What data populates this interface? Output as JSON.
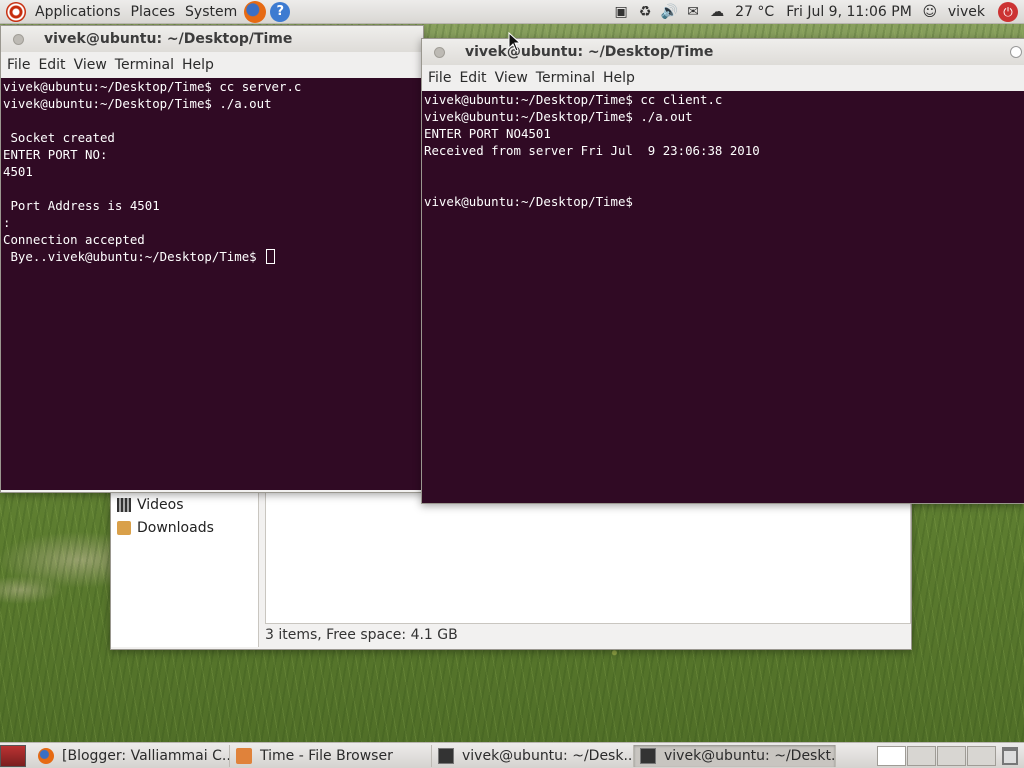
{
  "top_panel": {
    "menus": [
      "Applications",
      "Places",
      "System"
    ],
    "weather": "27 °C",
    "clock": "Fri Jul  9, 11:06 PM",
    "user": "vivek"
  },
  "server_window": {
    "title": "vivek@ubuntu: ~/Desktop/Time",
    "menu": [
      "File",
      "Edit",
      "View",
      "Terminal",
      "Help"
    ],
    "output": "vivek@ubuntu:~/Desktop/Time$ cc server.c\nvivek@ubuntu:~/Desktop/Time$ ./a.out\n\n Socket created\nENTER PORT NO:\n4501\n\n Port Address is 4501\n:\nConnection accepted\n Bye..vivek@ubuntu:~/Desktop/Time$ "
  },
  "client_window": {
    "title": "vivek@ubuntu: ~/Desktop/Time",
    "menu": [
      "File",
      "Edit",
      "View",
      "Terminal",
      "Help"
    ],
    "output": "vivek@ubuntu:~/Desktop/Time$ cc client.c\nvivek@ubuntu:~/Desktop/Time$ ./a.out\nENTER PORT NO4501\nReceived from server Fri Jul  9 23:06:38 2010\n\n\nvivek@ubuntu:~/Desktop/Time$ "
  },
  "file_browser": {
    "sidebar_items": [
      "Videos",
      "Downloads"
    ],
    "status": "3 items, Free space: 4.1 GB"
  },
  "taskbar": {
    "tasks": [
      "[Blogger: Valliammai C...",
      "Time - File Browser",
      "vivek@ubuntu: ~/Desk...",
      "vivek@ubuntu: ~/Deskt..."
    ]
  },
  "colors": {
    "terminal_bg": "#300a24",
    "terminal_fg": "#ffffff"
  }
}
